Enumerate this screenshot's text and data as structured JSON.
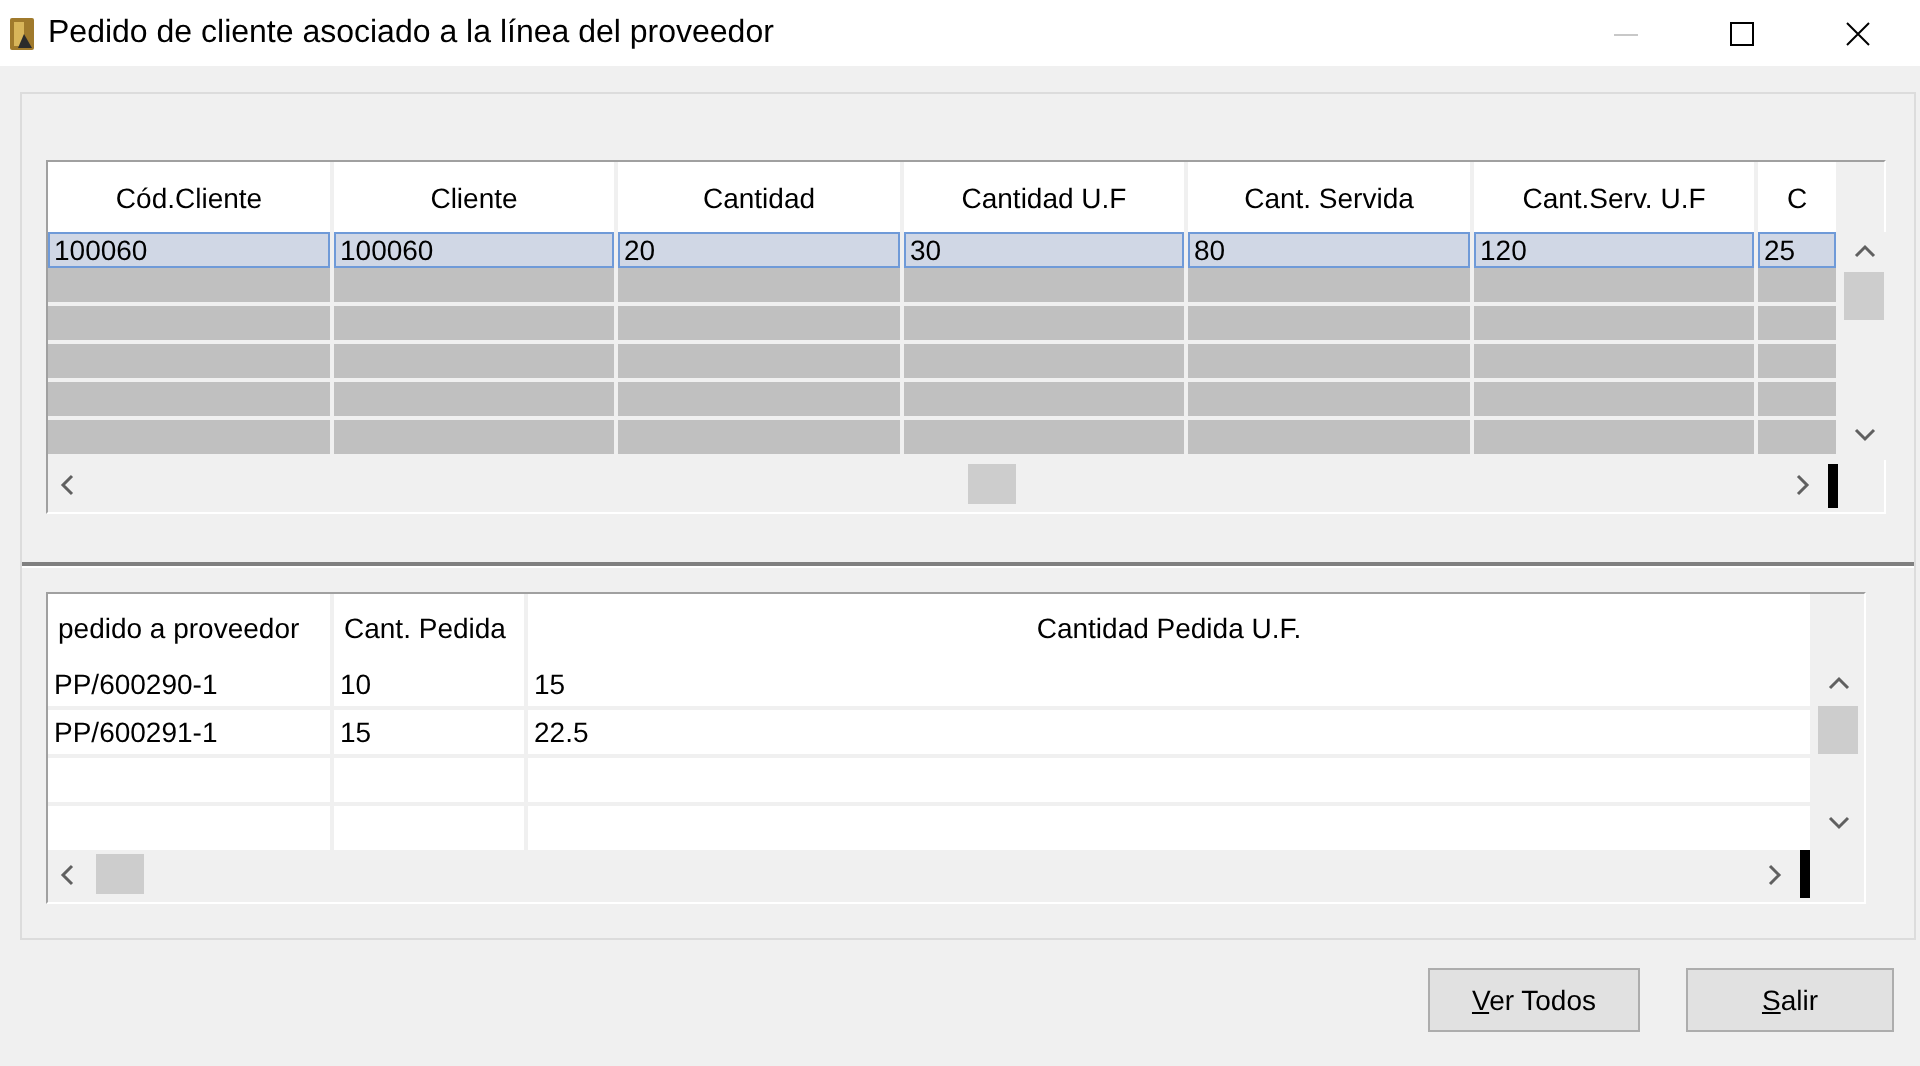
{
  "window": {
    "title": "Pedido de cliente asociado a la línea del proveedor"
  },
  "top_table": {
    "columns": [
      "Cód.Cliente",
      "Cliente",
      "Cantidad",
      "Cantidad U.F",
      "Cant. Servida",
      "Cant.Serv. U.F",
      "C"
    ],
    "rows": [
      {
        "cells": [
          "100060",
          "100060",
          "20",
          "30",
          "80",
          "120",
          "25"
        ],
        "selected": true
      }
    ]
  },
  "bottom_table": {
    "columns": [
      "pedido a proveedor",
      "Cant. Pedida",
      "Cantidad Pedida U.F."
    ],
    "rows": [
      {
        "cells": [
          "PP/600290-1",
          "10",
          "15"
        ],
        "selected": false
      },
      {
        "cells": [
          "PP/600291-1",
          "15",
          "22.5"
        ],
        "selected": false
      }
    ]
  },
  "buttons": [
    "Ver Todos",
    "Salir"
  ]
}
